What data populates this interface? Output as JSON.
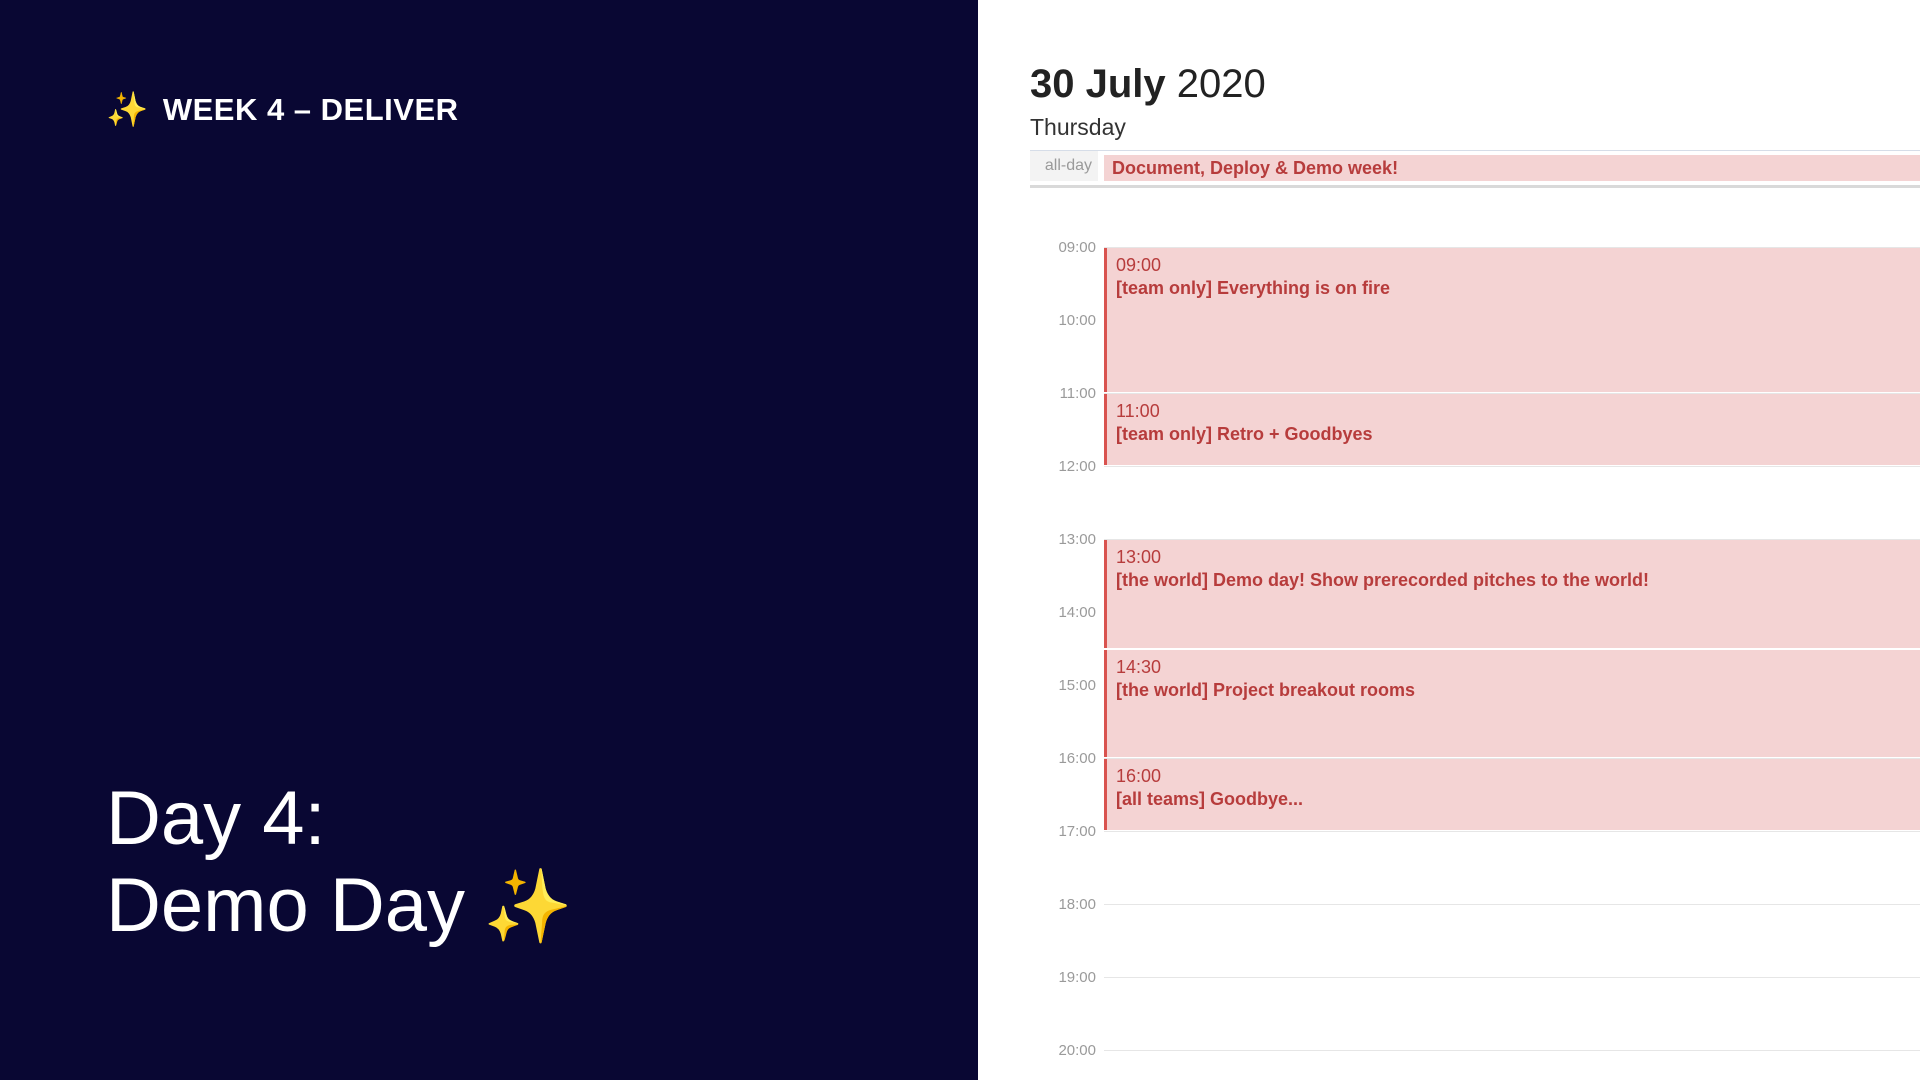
{
  "slide": {
    "week_label": "WEEK 4 – DELIVER",
    "title_line1": "Day 4:",
    "title_line2": "Demo Day",
    "sparkle": "✨"
  },
  "calendar": {
    "date_bold": "30 July",
    "year": "2020",
    "weekday": "Thursday",
    "allday_label": "all-day",
    "allday_event": "Document, Deploy & Demo week!",
    "hours": [
      "09:00",
      "10:00",
      "11:00",
      "12:00",
      "13:00",
      "14:00",
      "15:00",
      "16:00",
      "17:00",
      "18:00",
      "19:00",
      "20:00"
    ],
    "events": [
      {
        "time": "09:00",
        "title": "[team only] Everything is on fire"
      },
      {
        "time": "11:00",
        "title": "[team only] Retro + Goodbyes"
      },
      {
        "time": "13:00",
        "title": "[the world] Demo day! Show prerecorded pitches to the world!"
      },
      {
        "time": "14:30",
        "title": "[the world] Project breakout rooms"
      },
      {
        "time": "16:00",
        "title": "[all teams] Goodbye..."
      }
    ]
  },
  "colors": {
    "panel_bg": "#090733",
    "event_bg": "#f4d3d3",
    "event_text": "#b73c3c",
    "event_border": "#d9534f"
  }
}
